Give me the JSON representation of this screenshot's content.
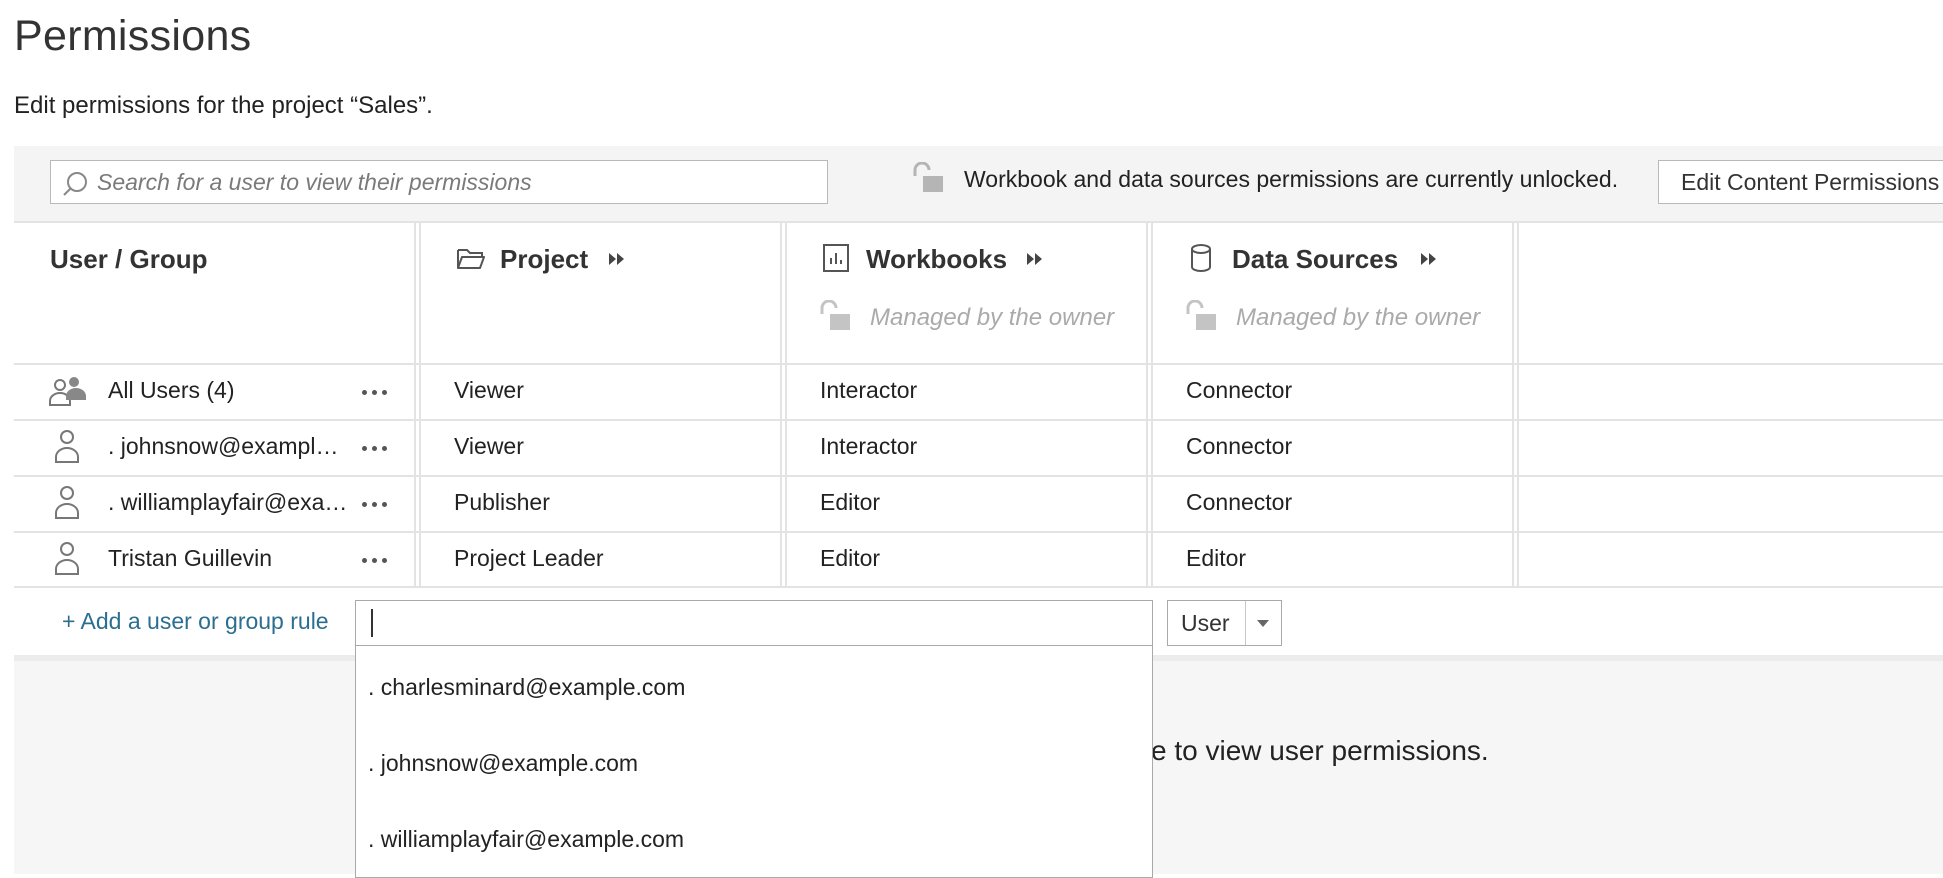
{
  "page": {
    "title": "Permissions",
    "subtitle": "Edit permissions for the project “Sales”."
  },
  "toolbar": {
    "search_placeholder": "Search for a user to view their permissions",
    "lock_message": "Workbook and data sources permissions are currently unlocked.",
    "edit_button": "Edit Content Permissions"
  },
  "columns": {
    "user_group": "User / Group",
    "project": "Project",
    "workbooks": "Workbooks",
    "data_sources": "Data Sources",
    "workbooks_note": "Managed by the owner",
    "data_sources_note": "Managed by the owner"
  },
  "rows": [
    {
      "name": "All Users (4)",
      "type": "group",
      "project": "Viewer",
      "workbooks": "Interactor",
      "data_sources": "Connector"
    },
    {
      "name": ". johnsnow@example.com",
      "type": "user",
      "project": "Viewer",
      "workbooks": "Interactor",
      "data_sources": "Connector"
    },
    {
      "name": ". williamplayfair@example.com",
      "type": "user",
      "project": "Publisher",
      "workbooks": "Editor",
      "data_sources": "Connector"
    },
    {
      "name": "Tristan Guillevin",
      "type": "user",
      "project": "Project Leader",
      "workbooks": "Editor",
      "data_sources": "Editor"
    }
  ],
  "add_rule": {
    "label": "+ Add a user or group rule",
    "input_value": "",
    "type_selected": "User"
  },
  "dropdown": {
    "items": [
      ". charlesminard@example.com",
      ". johnsnow@example.com",
      ". williamplayfair@example.com"
    ]
  },
  "bottom": {
    "message": "e to view user permissions."
  },
  "colors": {
    "link": "#2b6e8f",
    "muted": "#aaaaaa",
    "grid_line": "#e3e3e3",
    "toolbar_bg": "#f4f4f4"
  },
  "icons": {
    "search": "search-icon",
    "lock": "unlocked-lock-icon",
    "project": "folder-icon",
    "workbooks": "workbook-icon",
    "data_sources": "database-icon",
    "expand": "double-chevron-right-icon",
    "group": "group-icon",
    "user": "user-icon",
    "more": "more-dots-icon"
  }
}
